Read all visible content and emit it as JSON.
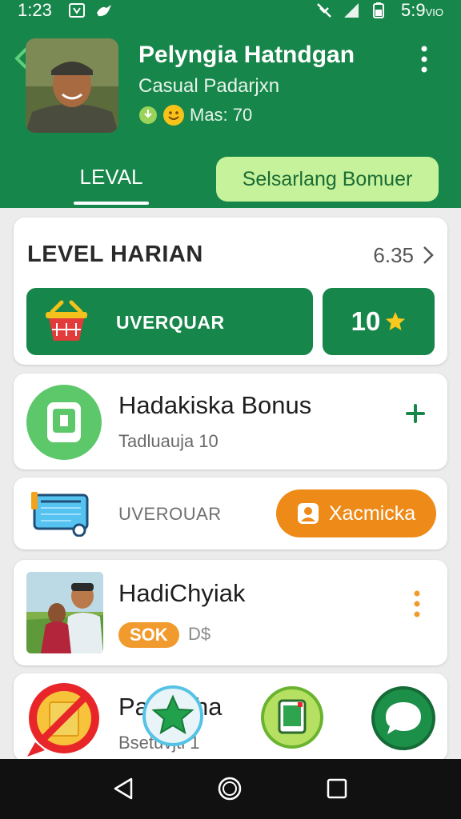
{
  "status_bar": {
    "time": "1:23",
    "clock": "5:9",
    "clock_suffix": "VIO"
  },
  "profile": {
    "name": "Pelyngia Hatndgan",
    "subtitle": "Casual Padarjxn",
    "meta": "Mas: 70"
  },
  "tabs": {
    "level_tab": "LEVAL",
    "action_pill": "Selsarlang Bomuer"
  },
  "daily": {
    "title": "LEVEL HARIAN",
    "value": "6.35",
    "button_label": "UVERQUAR",
    "count": "10"
  },
  "bonus_row": {
    "title": "Hadakiska Bonus",
    "subtitle": "Tadluauja 10"
  },
  "ticket_row": {
    "label": "UVEROUAR",
    "button": "Xacmicka"
  },
  "photo_row": {
    "title": "HadiChyiak",
    "badge": "SOK",
    "currency": "D$"
  },
  "partial_row": {
    "title": "Pa",
    "title_tail": "ha",
    "subtitle": "Bsetuvjti 1"
  },
  "colors": {
    "header_green": "#17864a",
    "pill_green": "#c5f29a",
    "orange": "#ee8a17",
    "card_bg": "#ffffff",
    "page_bg": "#ececec"
  },
  "icons": {
    "back": "chevron-left-icon",
    "more": "kebab-vertical-icon",
    "basket": "shopping-basket-icon",
    "star": "star-icon",
    "phone": "phone-icon",
    "plus": "plus-icon",
    "ticket": "ticket-icon",
    "person": "person-icon",
    "chat": "chat-bubble-icon",
    "nav_back": "triangle-back-icon",
    "nav_home": "circle-home-icon",
    "nav_recent": "square-recent-icon"
  }
}
